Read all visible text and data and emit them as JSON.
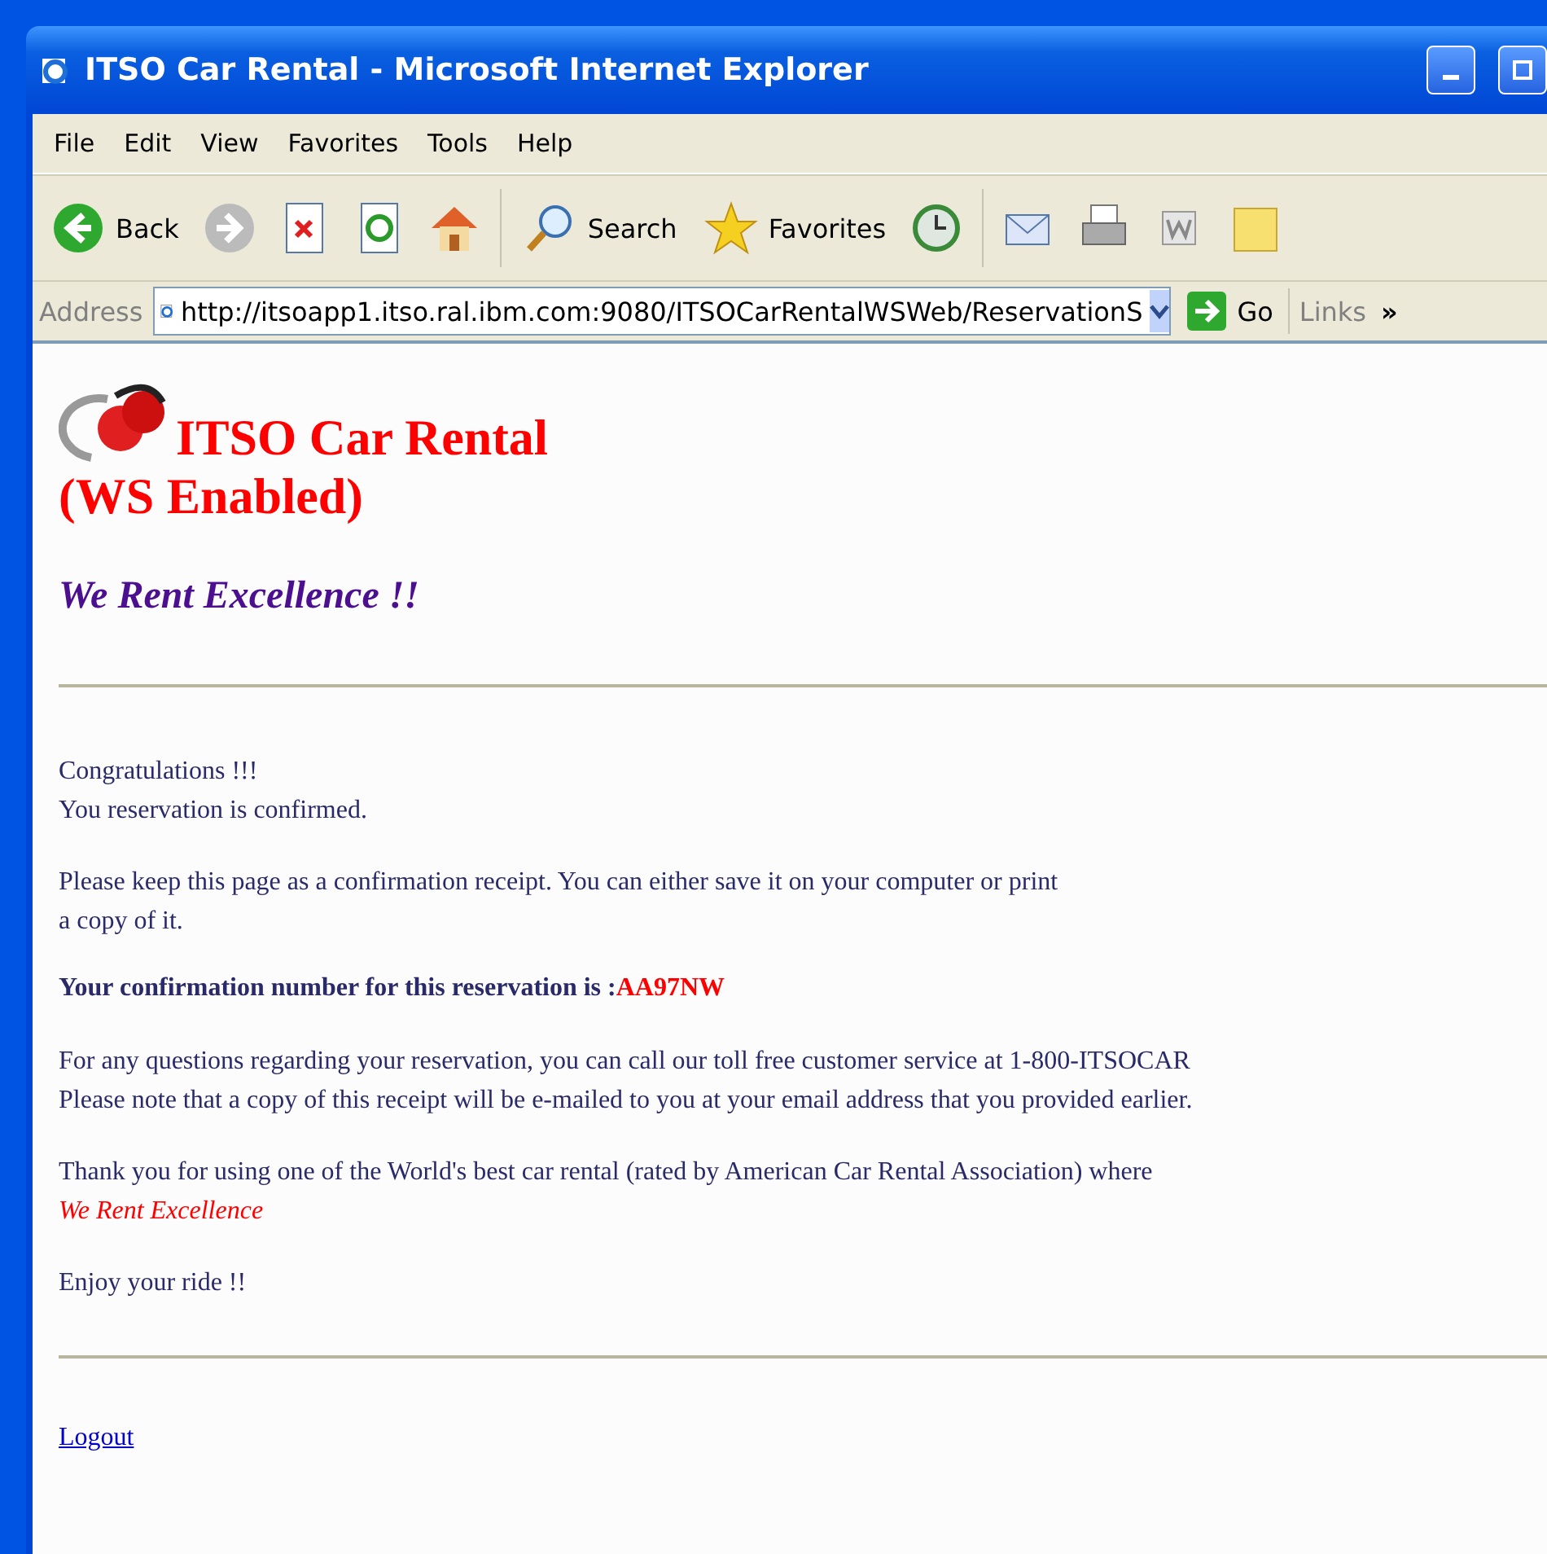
{
  "window": {
    "title": "ITSO Car Rental - Microsoft Internet Explorer"
  },
  "menu": [
    "File",
    "Edit",
    "View",
    "Favorites",
    "Tools",
    "Help"
  ],
  "toolbar": {
    "back": "Back",
    "search": "Search",
    "favorites": "Favorites"
  },
  "address_bar": {
    "label": "Address",
    "url": "http://itsoapp1.itso.ral.ibm.com:9080/ITSOCarRentalWSWeb/ReservationS",
    "go": "Go",
    "links": "Links",
    "chevron": "»"
  },
  "page": {
    "heading": "ITSO Car Rental",
    "subheading": "(WS Enabled)",
    "slogan": "We Rent Excellence !!",
    "paragraphs": [
      {
        "lines": [
          "Congratulations !!!",
          "You reservation is confirmed."
        ]
      },
      {
        "lines": [
          "Please keep this page as a confirmation receipt. You can either save it on your computer or print",
          "a copy of it."
        ]
      }
    ],
    "confirmation": {
      "label": "Your confirmation number for this reservation is :",
      "number": "AA97NW"
    },
    "paragraphs_after": [
      {
        "lines": [
          "For any questions regarding your reservation, you can call our toll free customer service at 1-800-ITSOCAR",
          "Please note that a copy of this receipt will be e-mailed to you at your email address that you provided earlier."
        ]
      }
    ],
    "thanks": {
      "text": "Thank you for using one of the World's best car rental (rated by American Car Rental Association) where",
      "slogan": "We Rent Excellence"
    },
    "closing": "Enjoy your ride !!",
    "logout": "Logout"
  }
}
